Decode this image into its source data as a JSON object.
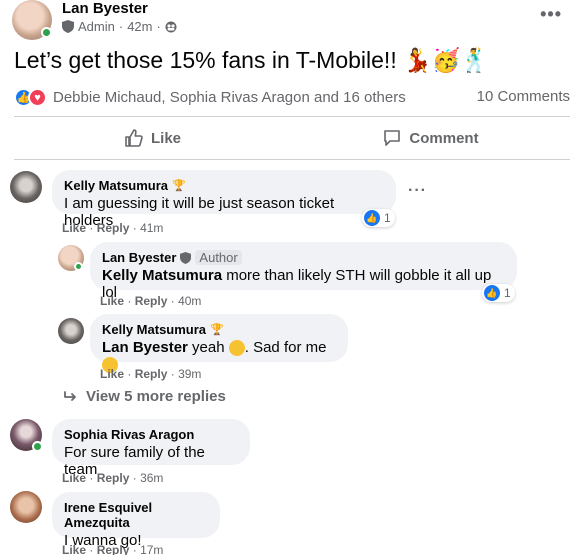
{
  "post": {
    "author": "Lan Byester",
    "role": "Admin",
    "time": "42m",
    "text": "Let’s get those 15% fans in T-Mobile!! 💃🥳🕺",
    "reaction_names": "Debbie Michaud, Sophia Rivas Aragon and 16 others",
    "comment_count": "10 Comments"
  },
  "actions": {
    "like": "Like",
    "comment": "Comment"
  },
  "comments": [
    {
      "name": "Kelly Matsumura",
      "text": "I am guessing it will be just season ticket holders",
      "time": "41m",
      "likes": "1"
    },
    {
      "name": "Lan Byester",
      "badge": "Author",
      "mention": "Kelly Matsumura",
      "text": " more than likely STH will gobble it all up lol",
      "time": "40m",
      "likes": "1"
    },
    {
      "name": "Kelly Matsumura",
      "mention": "Lan Byester",
      "text_a": " yeah ",
      "text_b": ". Sad for me ",
      "time": "39m"
    },
    {
      "name": "Sophia Rivas Aragon",
      "text": "For sure family of the team",
      "time": "36m"
    },
    {
      "name": "Irene Esquivel Amezquita",
      "text": "I wanna go!",
      "time": "17m"
    }
  ],
  "labels": {
    "like": "Like",
    "reply": "Reply",
    "sep": "·",
    "view_more": "View 5 more replies"
  },
  "colors": {
    "like_blue": "#1877f2",
    "love_red": "#f33e58",
    "online": "#31a24c"
  }
}
